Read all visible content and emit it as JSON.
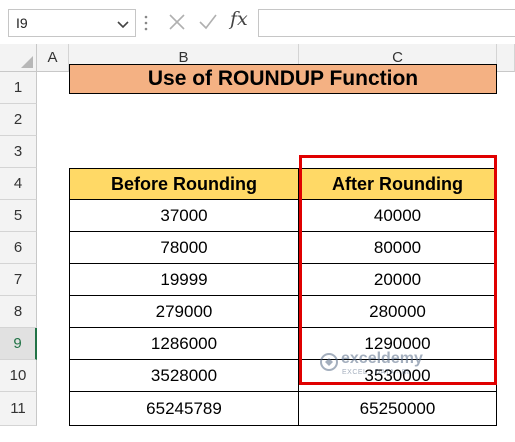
{
  "formula_bar": {
    "name_box": "I9",
    "fx_label": "fx",
    "formula": ""
  },
  "columns": [
    "A",
    "B",
    "C"
  ],
  "rows": [
    "1",
    "2",
    "3",
    "4",
    "5",
    "6",
    "7",
    "8",
    "9",
    "10",
    "11"
  ],
  "selected_row": "9",
  "title": "Use of ROUNDUP Function",
  "table": {
    "headers": [
      "Before Rounding",
      "After Rounding"
    ],
    "rows": [
      [
        "37000",
        "40000"
      ],
      [
        "78000",
        "80000"
      ],
      [
        "19999",
        "20000"
      ],
      [
        "279000",
        "280000"
      ],
      [
        "1286000",
        "1290000"
      ],
      [
        "3528000",
        "3530000"
      ],
      [
        "65245789",
        "65250000"
      ]
    ]
  },
  "watermark": {
    "name": "exceldemy",
    "tagline": "EXCEL · DATA · BI"
  },
  "colors": {
    "title_fill": "#f4b183",
    "header_fill": "#ffd966",
    "highlight_border": "#e00000",
    "selected_row_accent": "#217346"
  }
}
